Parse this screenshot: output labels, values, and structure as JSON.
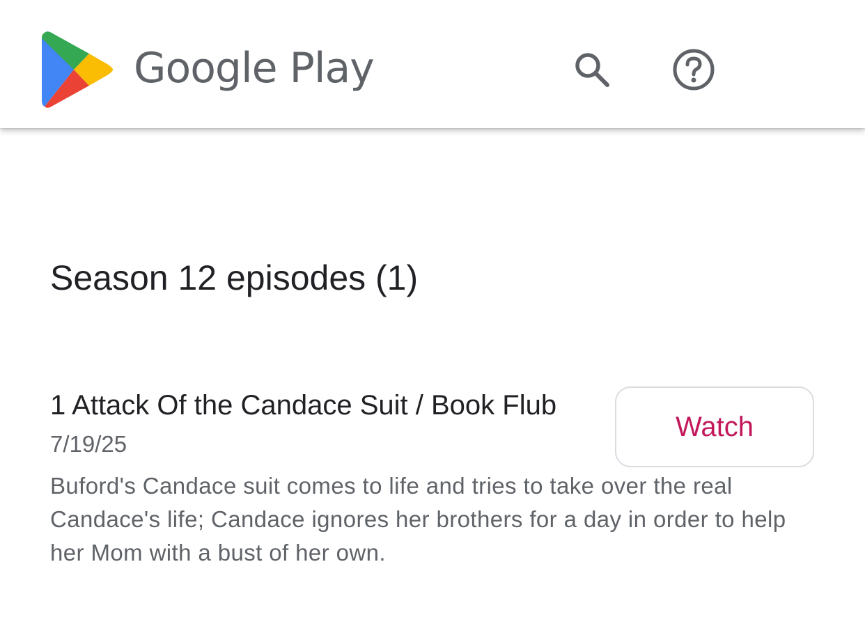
{
  "header": {
    "brand_name": "Google Play",
    "logo_icon": "google-play-logo-icon",
    "search_icon": "search-icon",
    "help_icon": "help-circle-icon"
  },
  "season": {
    "title": "Season 12 episodes (1)"
  },
  "episodes": [
    {
      "title": "1 Attack Of the Candace Suit / Book Flub",
      "date": "7/19/25",
      "description": "Buford's Candace suit comes to life and tries to take over the real Candace's life; Candace ignores her brothers for a day in order to help her Mom with a bust of her own.",
      "watch_label": "Watch"
    }
  ],
  "colors": {
    "accent": "#c2185b",
    "text_primary": "#202124",
    "text_secondary": "#5f6368",
    "border": "#dadce0"
  }
}
